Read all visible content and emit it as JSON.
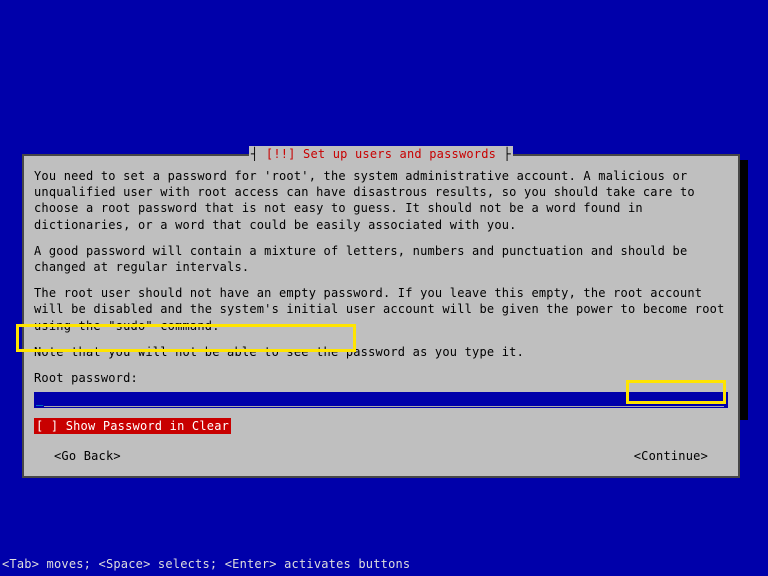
{
  "dialog": {
    "title_prefix": "[!!] ",
    "title_text": "Set up users and passwords",
    "para1": "You need to set a password for 'root', the system administrative account. A malicious or unqualified user with root access can have disastrous results, so you should take care to choose a root password that is not easy to guess. It should not be a word found in dictionaries, or a word that could be easily associated with you.",
    "para2": "A good password will contain a mixture of letters, numbers and punctuation and should be changed at regular intervals.",
    "para3": "The root user should not have an empty password. If you leave this empty, the root account will be disabled and the system's initial user account will be given the power to become root using the \"sudo\" command.",
    "para4": "Note that you will not be able to see the password as you type it.",
    "field_label": "Root password:",
    "password_value": "",
    "checkbox_label": "[ ] Show Password in Clear",
    "go_back": "<Go Back>",
    "continue": "<Continue>"
  },
  "footer": {
    "hint": "<Tab> moves; <Space> selects; <Enter> activates buttons"
  }
}
